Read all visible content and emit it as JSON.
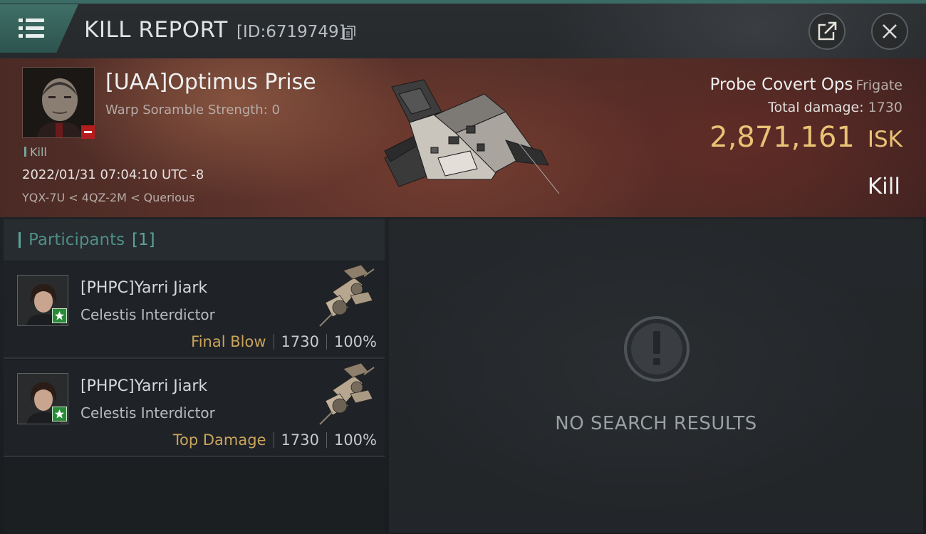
{
  "header": {
    "title": "KILL REPORT",
    "kill_id": "[ID:6719749]"
  },
  "victim": {
    "name": "[UAA]Optimus Prise",
    "warp_scramble": "Warp Soramble Strength: 0",
    "tag": "Kill",
    "datetime": "2022/01/31 07:04:10 UTC -8",
    "location": "YQX-7U < 4QZ-2M < Querious",
    "ship_name": "Probe Covert Ops",
    "ship_class": "Frigate",
    "total_damage_label": "Total damage:",
    "total_damage_value": "1730",
    "isk_value": "2,871,161",
    "isk_unit": "ISK",
    "kill_label": "Kill"
  },
  "participants": {
    "title": "Participants",
    "count": "[1]",
    "rows": [
      {
        "name": "[PHPC]Yarri Jiark",
        "ship": "Celestis Interdictor",
        "role": "Final Blow",
        "damage": "1730",
        "percent": "100%"
      },
      {
        "name": "[PHPC]Yarri Jiark",
        "ship": "Celestis Interdictor",
        "role": "Top Damage",
        "damage": "1730",
        "percent": "100%"
      }
    ]
  },
  "results": {
    "empty_text": "NO SEARCH RESULTS"
  },
  "icons": {
    "menu": "hamburger-menu-icon",
    "copy": "copy-icon",
    "share": "share-export-icon",
    "close": "close-icon",
    "alert": "exclamation-icon"
  },
  "colors": {
    "accent": "#5ea39a",
    "isk": "#e9c276",
    "role": "#c9a45c",
    "security_badge": "#b31d1d",
    "standing_badge": "#2a8a3a"
  }
}
